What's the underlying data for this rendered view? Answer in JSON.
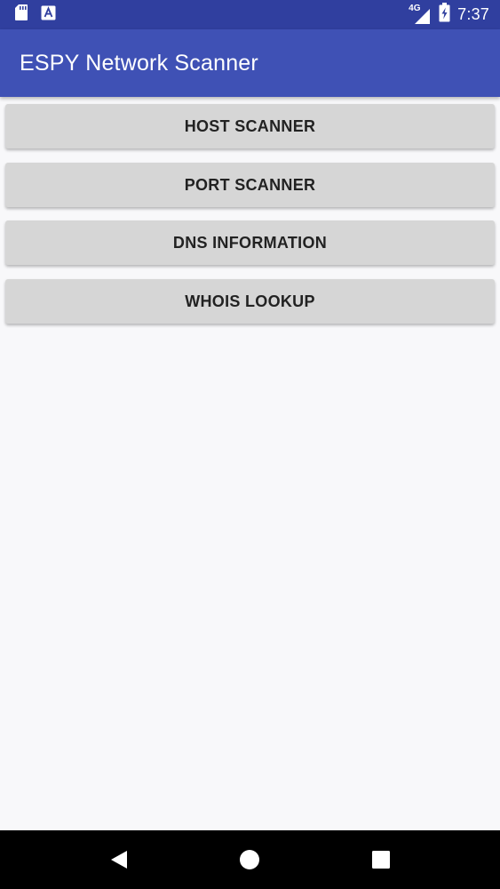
{
  "status_bar": {
    "time": "7:37",
    "network_type": "4G",
    "icons": [
      "sd-card-icon",
      "font-app-icon",
      "signal-icon",
      "battery-icon"
    ],
    "color": "#303f9f"
  },
  "app_bar": {
    "title": "ESPY Network Scanner",
    "color": "#3f51b5"
  },
  "menu": {
    "buttons": [
      {
        "label": "HOST SCANNER"
      },
      {
        "label": "PORT SCANNER"
      },
      {
        "label": "DNS INFORMATION"
      },
      {
        "label": "WHOIS LOOKUP"
      }
    ]
  },
  "nav_bar": {
    "icons": [
      "back-icon",
      "home-icon",
      "recents-icon"
    ]
  }
}
